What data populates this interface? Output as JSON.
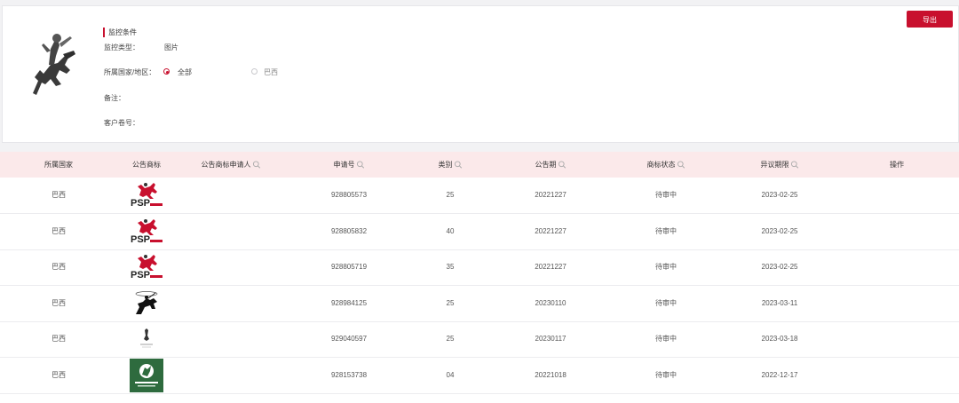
{
  "filter": {
    "section_title": "监控条件",
    "monitor_type_label": "监控类型：",
    "monitor_type_value": "图片",
    "country_label": "所属国家/地区：",
    "country_options": [
      {
        "label": "全部",
        "selected": true
      },
      {
        "label": "巴西",
        "selected": false
      }
    ],
    "note_label": "备注：",
    "customer_no_label": "客户卷号：",
    "logo_icon": "knight-on-horse-icon"
  },
  "toolbar": {
    "export_label": "导出"
  },
  "table": {
    "headers": [
      "所属国家",
      "公告商标",
      "公告商标申请人",
      "申请号",
      "类别",
      "公告期",
      "商标状态",
      "异议期限",
      "操作"
    ],
    "searchable": [
      false,
      false,
      true,
      true,
      true,
      true,
      true,
      true,
      false
    ],
    "rows": [
      {
        "country": "巴西",
        "mark": "psp-horse-logo",
        "applicant": "",
        "app_no": "928805573",
        "class": "25",
        "pub_date": "20221227",
        "status": "待审中",
        "deadline": "2023-02-25",
        "action": ""
      },
      {
        "country": "巴西",
        "mark": "psp-horse-logo",
        "applicant": "",
        "app_no": "928805832",
        "class": "40",
        "pub_date": "20221227",
        "status": "待审中",
        "deadline": "2023-02-25",
        "action": ""
      },
      {
        "country": "巴西",
        "mark": "psp-horse-logo",
        "applicant": "",
        "app_no": "928805719",
        "class": "35",
        "pub_date": "20221227",
        "status": "待审中",
        "deadline": "2023-02-25",
        "action": ""
      },
      {
        "country": "巴西",
        "mark": "polo-rider-logo",
        "applicant": "",
        "app_no": "928984125",
        "class": "25",
        "pub_date": "20230110",
        "status": "待审中",
        "deadline": "2023-03-11",
        "action": ""
      },
      {
        "country": "巴西",
        "mark": "small-rider-logo",
        "applicant": "",
        "app_no": "929040597",
        "class": "25",
        "pub_date": "20230117",
        "status": "待审中",
        "deadline": "2023-03-18",
        "action": ""
      },
      {
        "country": "巴西",
        "mark": "green-square-logo",
        "applicant": "",
        "app_no": "928153738",
        "class": "04",
        "pub_date": "20221018",
        "status": "待审中",
        "deadline": "2022-12-17",
        "action": ""
      }
    ]
  },
  "colors": {
    "accent": "#c8102e",
    "header_bg": "#fbe9ea"
  }
}
